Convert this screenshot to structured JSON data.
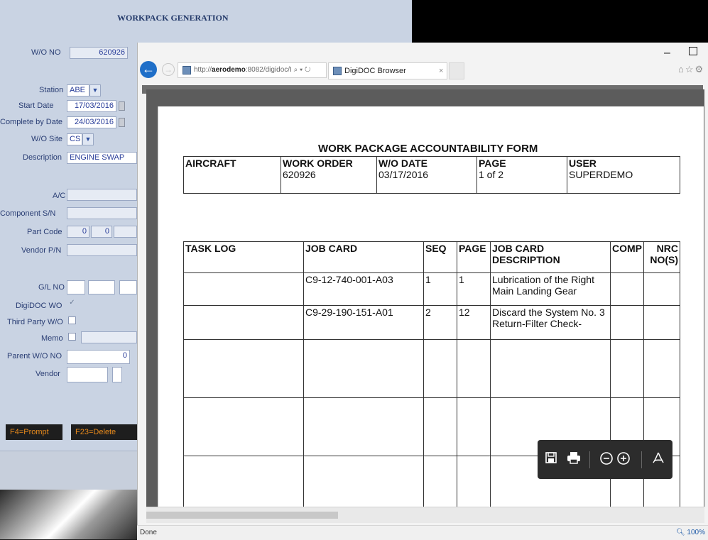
{
  "background_app": {
    "title": "WORKPACK GENERATION",
    "fields": {
      "wo_no": {
        "label": "W/O NO",
        "value": "620926"
      },
      "station": {
        "label": "Station",
        "value": "ABE"
      },
      "start_date": {
        "label": "Start Date",
        "value": "17/03/2016"
      },
      "complete_by_date": {
        "label": "Complete by Date",
        "value": "24/03/2016"
      },
      "wo_site": {
        "label": "W/O Site",
        "value": "CS"
      },
      "description": {
        "label": "Description",
        "value": "ENGINE SWAP"
      },
      "ac": {
        "label": "A/C",
        "value": ""
      },
      "component_sn": {
        "label": "Component S/N",
        "value": ""
      },
      "part_code": {
        "label": "Part Code",
        "value1": "0",
        "value2": "0"
      },
      "vendor_pn": {
        "label": "Vendor P/N",
        "value": ""
      },
      "gl_no": {
        "label": "G/L NO",
        "value": ""
      },
      "digidoc_wo": {
        "label": "DigiDOC WO",
        "checked": true
      },
      "third_party_wo": {
        "label": "Third Party W/O",
        "checked": false
      },
      "memo": {
        "label": "Memo",
        "checked": false
      },
      "parent_wo_no": {
        "label": "Parent W/O NO",
        "value": "0"
      },
      "vendor": {
        "label": "Vendor",
        "value": ""
      }
    },
    "function_keys": [
      "F4=Prompt",
      "F23=Delete"
    ]
  },
  "browser": {
    "address_prefix": "http://",
    "address_host": "aerodemo",
    "address_rest": ":8082/digidoc/I",
    "tab_title": "DigiDOC Browser",
    "tab_close": "×",
    "status_text": "Done",
    "zoom_text": "100%",
    "window_min": "–",
    "search_refresh_icons": "⌕ ▾ ↻",
    "nav_icons": "⌂☆⚙"
  },
  "document": {
    "form_title": "WORK PACKAGE ACCOUNTABILITY FORM",
    "header": {
      "aircraft_label": "AIRCRAFT",
      "aircraft_value": "",
      "work_order_label": "WORK ORDER",
      "work_order_value": "620926",
      "wo_date_label": "W/O DATE",
      "wo_date_value": "03/17/2016",
      "page_label": "PAGE",
      "page_value": "1 of 2",
      "user_label": "USER",
      "user_value": "SUPERDEMO"
    },
    "table": {
      "columns": [
        "TASK LOG",
        "JOB CARD",
        "SEQ",
        "PAGE",
        "JOB CARD DESCRIPTION",
        "COMP",
        "NRC NO(S)"
      ],
      "rows": [
        {
          "task_log": "",
          "job_card": "C9-12-740-001-A03",
          "seq": "1",
          "page": "1",
          "description": "Lubrication of the Right Main Landing Gear",
          "comp": "",
          "nrc": ""
        },
        {
          "task_log": "",
          "job_card": "C9-29-190-151-A01",
          "seq": "2",
          "page": "12",
          "description": "Discard the System No. 3 Return-Filter Check-",
          "comp": "",
          "nrc": ""
        }
      ]
    }
  },
  "colors": {
    "app_bg": "#c9d3e3",
    "label_text": "#2a3e74",
    "fkey_text": "#e88a1c",
    "back_button": "#1f6fc8",
    "pdf_toolbar": "#2c2c2c"
  }
}
